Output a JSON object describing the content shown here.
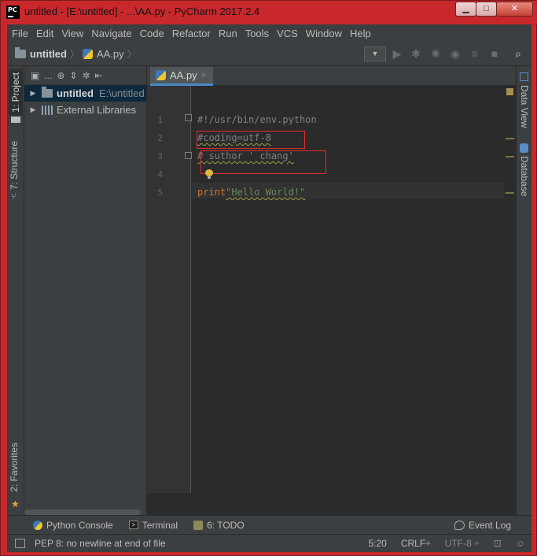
{
  "window": {
    "app_icon_label": "PC",
    "title": "untitled - [E:\\untitled] - ...\\AA.py - PyCharm 2017.2.4",
    "buttons": {
      "minimize": "▁",
      "maximize": "□",
      "close": "✕"
    }
  },
  "menu": [
    "File",
    "Edit",
    "View",
    "Navigate",
    "Code",
    "Refactor",
    "Run",
    "Tools",
    "VCS",
    "Window",
    "Help"
  ],
  "navbar": {
    "project": "untitled",
    "file": "AA.py",
    "run_config_arrow": "▼"
  },
  "left_strip": {
    "project_tab": "1: Project",
    "structure_tab": "7: Structure",
    "favorites_tab": "2: Favorites"
  },
  "project_panel": {
    "toolbar_label": "...",
    "tree": [
      {
        "name": "untitled",
        "path": "E:\\untitled",
        "selected": true,
        "bold": true
      },
      {
        "name": "External Libraries",
        "path": "",
        "selected": false,
        "bold": false
      }
    ]
  },
  "editor": {
    "tab_label": "AA.py",
    "tab_close": "×",
    "line_numbers": [
      "1",
      "2",
      "3",
      "4",
      "5"
    ],
    "lines": {
      "l1": "#!/usr/bin/env.python",
      "l2": "#coding=utf-8",
      "l3": "# suthor ' chang'",
      "l5_keyword": "print",
      "l5_string": "\"Hello World!\""
    }
  },
  "right_strip": {
    "data_view": "Data View",
    "database": "Database"
  },
  "bottom_tools": {
    "python_console": "Python Console",
    "terminal": "Terminal",
    "todo": "6: TODO",
    "event_log": "Event Log"
  },
  "status": {
    "message": "PEP 8: no newline at end of file",
    "position": "5:20",
    "line_sep": "CRLF÷",
    "encoding": "UTF-8 ÷"
  },
  "colors": {
    "accent_red": "#c8282c",
    "ide_bg": "#3c3f41",
    "editor_bg": "#2b2b2b",
    "comment": "#808080",
    "keyword": "#cc7832",
    "string": "#6a8759",
    "highlight_box": "#e12c2c"
  }
}
